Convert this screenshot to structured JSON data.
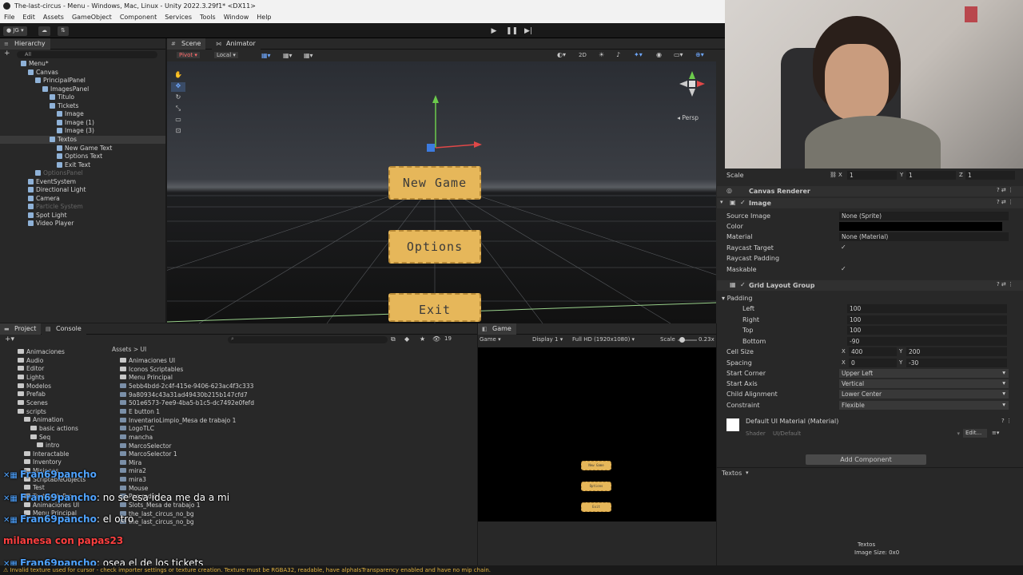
{
  "window": {
    "title": "The-last-circus - Menu - Windows, Mac, Linux - Unity 2022.3.29f1* <DX11>"
  },
  "menu": [
    "File",
    "Edit",
    "Assets",
    "GameObject",
    "Component",
    "Services",
    "Tools",
    "Window",
    "Help"
  ],
  "toolbar": {
    "account": "JG"
  },
  "tabs": {
    "hierarchy": "Hierarchy",
    "scene": "Scene",
    "animator": "Animator",
    "project": "Project",
    "console": "Console",
    "game": "Game"
  },
  "scene": {
    "pivot": "Pivot",
    "local": "Local",
    "mode2d": "2D",
    "persp": "Persp"
  },
  "hierarchy": {
    "search": "All",
    "rows": [
      {
        "label": "Menu*",
        "dim": false
      },
      {
        "label": "Canvas",
        "dim": false
      },
      {
        "label": "PrincipalPanel",
        "dim": false
      },
      {
        "label": "ImagesPanel",
        "dim": false
      },
      {
        "label": "Titulo",
        "dim": false
      },
      {
        "label": "Tickets",
        "dim": false
      },
      {
        "label": "Image",
        "dim": false
      },
      {
        "label": "Image (1)",
        "dim": false
      },
      {
        "label": "Image (3)",
        "dim": false
      },
      {
        "label": "Textos",
        "dim": false
      },
      {
        "label": "New Game Text",
        "dim": false
      },
      {
        "label": "Options Text",
        "dim": false
      },
      {
        "label": "Exit Text",
        "dim": false
      },
      {
        "label": "OptionsPanel",
        "dim": true
      },
      {
        "label": "EventSystem",
        "dim": false
      },
      {
        "label": "Directional Light",
        "dim": false
      },
      {
        "label": "Camera",
        "dim": false
      },
      {
        "label": "Particle System",
        "dim": true
      },
      {
        "label": "Spot Light",
        "dim": false
      },
      {
        "label": "Video Player",
        "dim": false
      }
    ]
  },
  "tickets": {
    "new_game": "New Game",
    "options": "Options",
    "exit": "Exit"
  },
  "game_view": {
    "label": "Game",
    "display": "Display 1",
    "resolution": "Full HD (1920x1080)",
    "scale_label": "Scale",
    "scale_value": "0.23x"
  },
  "project": {
    "breadcrumb_root": "Assets",
    "breadcrumb_sep": ">",
    "breadcrumb_leaf": "UI",
    "hidden_count": "19",
    "tree": [
      "Animaciones",
      "Audio",
      "Editor",
      "Lights",
      "Modelos",
      "Prefab",
      "Scenes",
      "scripts",
      "Animation",
      "basic actions",
      "Seq",
      "intro",
      "Interactable",
      "Inventory",
      "Misiones",
      "ScriptableObjects",
      "Test",
      "TextMesh Pro",
      "Animaciones UI",
      "Menu Principal"
    ],
    "assets": [
      "Animaciones UI",
      "Iconos Scriptables",
      "Menu Principal",
      "5ebb4bdd-2c4f-415e-9406-623ac4f3c333",
      "9a80934c43a31ad49430b215b147cfd7",
      "501e6573-7ee9-4ba5-b1c5-dc7492e0fefd",
      "E button 1",
      "InventarioLimpio_Mesa de trabajo 1",
      "LogoTLC",
      "mancha",
      "MarcoSelector",
      "MarcoSelector 1",
      "Mira",
      "mira2",
      "mira3",
      "Mouse",
      "Png radio",
      "Slots_Mesa de trabajo 1",
      "the_last_circus_no_bg",
      "the_last_circus_no_bg"
    ]
  },
  "inspector": {
    "scale": {
      "label": "Scale",
      "x": "1",
      "y": "1",
      "z": "1"
    },
    "canvas_renderer": "Canvas Renderer",
    "image": {
      "header": "Image",
      "source_image_label": "Source Image",
      "source_image": "None (Sprite)",
      "color_label": "Color",
      "color": "#000000",
      "material_label": "Material",
      "material": "None (Material)",
      "raycast_target_label": "Raycast Target",
      "raycast_padding_label": "Raycast Padding",
      "maskable_label": "Maskable"
    },
    "grid": {
      "header": "Grid Layout Group",
      "padding_label": "Padding",
      "left_label": "Left",
      "left": "100",
      "right_label": "Right",
      "right": "100",
      "top_label": "Top",
      "top": "100",
      "bottom_label": "Bottom",
      "bottom": "-90",
      "cell_size_label": "Cell Size",
      "cell_x": "400",
      "cell_y": "200",
      "spacing_label": "Spacing",
      "spacing_x": "0",
      "spacing_y": "-30",
      "start_corner_label": "Start Corner",
      "start_corner": "Upper Left",
      "start_axis_label": "Start Axis",
      "start_axis": "Vertical",
      "child_alignment_label": "Child Alignment",
      "child_alignment": "Lower Center",
      "constraint_label": "Constraint",
      "constraint": "Flexible"
    },
    "material": {
      "name": "Default UI Material (Material)",
      "shader_label": "Shader",
      "shader": "UI/Default",
      "edit": "Edit..."
    },
    "add_component": "Add Component",
    "textos_label": "Textos",
    "preview_title": "Textos",
    "preview_size": "Image Size: 0x0"
  },
  "chat": [
    {
      "user": "Fran69pancho",
      "message": ""
    },
    {
      "user": "Fran69pancho",
      "message": "no se esa idea me da a mi"
    },
    {
      "user": "Fran69pancho",
      "message": "el otro"
    },
    {
      "user": "milanesa con papas23",
      "message": ""
    },
    {
      "user": "Fran69pancho",
      "message": "osea el de los tickets"
    }
  ],
  "status": "Invalid texture used for cursor - check importer settings or texture creation. Texture must be RGBA32, readable, have alphaIsTransparency enabled and have no mip chain.",
  "colors": {
    "accent": "#4fa3ff",
    "ticket": "#e6b75a",
    "warn": "#e3b340"
  }
}
